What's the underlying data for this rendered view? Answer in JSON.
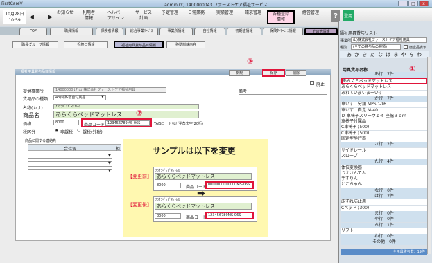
{
  "window": {
    "app": "FirstCareV",
    "title": "admin (Y) 1400000043 ファーストケア福祉サービス"
  },
  "menubar": {
    "date": "10月28日",
    "time": "10:59",
    "items": [
      "お知らせ",
      "利用者\n情報",
      "ヘルパー\nアサイン",
      "サービス\n計画",
      "予定管理",
      "日常業務",
      "実績管理",
      "請求管理",
      "各種登録\n情報",
      "経営管理"
    ],
    "help": "?",
    "login": "登用"
  },
  "tabs": [
    "TOP",
    "職員情報",
    "保険者情報",
    "総合事業ｻｰﾋﾞｽ",
    "事業所情報",
    "自社情報",
    "初期値情報",
    "保険外ｻｰﾋﾞｽ情報",
    "その他情報"
  ],
  "subtabs": [
    "職員グループ情報",
    "祝祭日情報",
    "福祉用具貸与品目情報",
    "移動訓練内容"
  ],
  "panel": {
    "header": "福祉用具貸与品目情報",
    "buttons": {
      "new": "新規",
      "save": "保存",
      "delete": "削除"
    },
    "abolish": "廃止",
    "labels": {
      "provider": "提供事業所",
      "category": "貸与品の種類",
      "kana": "名称(カナ)",
      "name": "商品名",
      "price": "価格",
      "tax": "税区分",
      "contact": "商品に関する連絡先",
      "remarks": "備考"
    },
    "provider_value": "1400000017 山)株式会社ファーストケア福祉用具",
    "category_value": "43)特殊寝台付属品",
    "kana_value": "ｱﾗｸﾗﾍﾞｯﾄﾞﾏｯﾄﾚｽ",
    "name_value": "あらくらベッドマットレス",
    "price_value": "8000",
    "code_label": "商品コード",
    "code_value": "123456789MS-06S",
    "code_note": "TAISコードなど半角文字(20桁)",
    "tax_options": [
      "非課税",
      "課税(外税)"
    ],
    "contact_cols": [
      "会社名",
      "担"
    ]
  },
  "annotations": {
    "c1": "①",
    "c2": "②",
    "c3": "③"
  },
  "sample": {
    "title": "サンプルは以下を変更",
    "before_label": "【変更前】",
    "after_label": "【変更後】",
    "kana": "ｱﾗｸﾗﾍﾞｯﾄﾞﾏｯﾄﾚｽ",
    "name": "あらくらベッドマットレス",
    "price": "8000",
    "code_label": "商品コード",
    "before_code": "0000000000000MS-06S",
    "after_code": "123456789MS-06S"
  },
  "rightpanel": {
    "title": "福祉用具貸与リスト",
    "provider_label": "事業所",
    "provider_value": "山)株式会社ファーストケア福祉用具",
    "type_label": "種別",
    "type_value": "(全ての貸与品の種類)",
    "abolish": "廃止品表示",
    "kana_row": "あ か き た な は ま や ら わ",
    "list_header": "用具貸与名称",
    "items": [
      {
        "t": "grp",
        "v": "あ行　7件"
      },
      {
        "t": "sel",
        "v": "あらくらベッドマットレス"
      },
      {
        "t": "item",
        "v": "あらくらベッドマットレス"
      },
      {
        "t": "item",
        "v": "あれていまいまーいす"
      },
      {
        "t": "grp",
        "v": "か行　7件"
      },
      {
        "t": "item",
        "v": "車いす　分類 MPSD-16"
      },
      {
        "t": "item",
        "v": "車いす　自走 M-40"
      },
      {
        "t": "item",
        "v": "Ｄ 車椅子スリーウェイ 座幅３ｃｍ"
      },
      {
        "t": "item",
        "v": "車椅子付属品"
      },
      {
        "t": "item",
        "v": "C車椅子 (500)"
      },
      {
        "t": "item",
        "v": "C車椅子 (500)"
      },
      {
        "t": "item",
        "v": "固定型歩行器"
      },
      {
        "t": "grp",
        "v": "さ行　2件"
      },
      {
        "t": "item",
        "v": "サイドレール"
      },
      {
        "t": "item",
        "v": "スロープ"
      },
      {
        "t": "grp",
        "v": "た行　4件"
      },
      {
        "t": "item",
        "v": "体位変換器"
      },
      {
        "t": "item",
        "v": "つえさんてん"
      },
      {
        "t": "item",
        "v": "手すりん"
      },
      {
        "t": "item",
        "v": "とこちゃん"
      },
      {
        "t": "grp",
        "v": "な行　0件"
      },
      {
        "t": "grp",
        "v": "は行　2件"
      },
      {
        "t": "item",
        "v": "床ずれ防止用"
      },
      {
        "t": "item",
        "v": "Cベッド (300)"
      },
      {
        "t": "grp",
        "v": "ま行　0件"
      },
      {
        "t": "grp",
        "v": "や行　0件"
      },
      {
        "t": "grp",
        "v": "ら行　1件"
      },
      {
        "t": "item",
        "v": "リフト"
      },
      {
        "t": "grp",
        "v": "わ行　0件"
      },
      {
        "t": "grp",
        "v": "その他　0件"
      }
    ],
    "footer": "全用具貸与数：19件"
  }
}
